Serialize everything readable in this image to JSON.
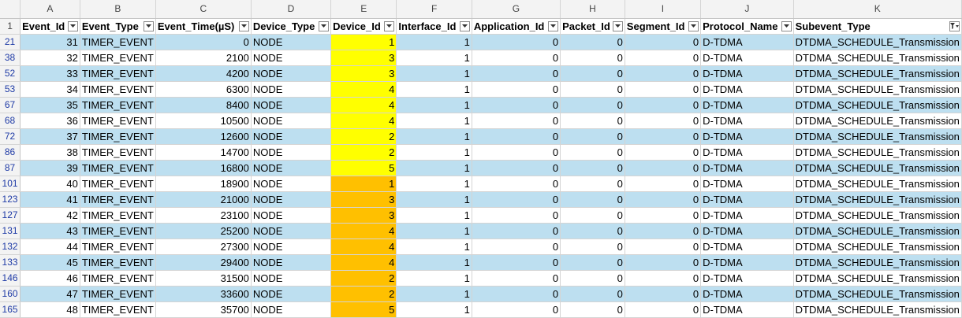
{
  "colors": {
    "band": "#bddff0",
    "device_yellow": "#ffff00",
    "device_orange": "#ffc000",
    "row_number": "#1f3ba6"
  },
  "column_letters": [
    "A",
    "B",
    "C",
    "D",
    "E",
    "F",
    "G",
    "H",
    "I",
    "J",
    "K"
  ],
  "header_row_number": "1",
  "headers": [
    "Event_Id",
    "Event_Type",
    "Event_Time(µS)",
    "Device_Type",
    "Device_Id",
    "Interface_Id",
    "Application_Id",
    "Packet_Id",
    "Segment_Id",
    "Protocol_Name",
    "Subevent_Type"
  ],
  "active_filter_column": "Subevent_Type",
  "rows": [
    {
      "rownum": "21",
      "cells": [
        "31",
        "TIMER_EVENT",
        "0",
        "NODE",
        "1",
        "1",
        "0",
        "0",
        "0",
        "D-TDMA",
        "DTDMA_SCHEDULE_Transmission"
      ],
      "device_highlight": "yellow"
    },
    {
      "rownum": "38",
      "cells": [
        "32",
        "TIMER_EVENT",
        "2100",
        "NODE",
        "3",
        "1",
        "0",
        "0",
        "0",
        "D-TDMA",
        "DTDMA_SCHEDULE_Transmission"
      ],
      "device_highlight": "yellow"
    },
    {
      "rownum": "52",
      "cells": [
        "33",
        "TIMER_EVENT",
        "4200",
        "NODE",
        "3",
        "1",
        "0",
        "0",
        "0",
        "D-TDMA",
        "DTDMA_SCHEDULE_Transmission"
      ],
      "device_highlight": "yellow"
    },
    {
      "rownum": "53",
      "cells": [
        "34",
        "TIMER_EVENT",
        "6300",
        "NODE",
        "4",
        "1",
        "0",
        "0",
        "0",
        "D-TDMA",
        "DTDMA_SCHEDULE_Transmission"
      ],
      "device_highlight": "yellow"
    },
    {
      "rownum": "67",
      "cells": [
        "35",
        "TIMER_EVENT",
        "8400",
        "NODE",
        "4",
        "1",
        "0",
        "0",
        "0",
        "D-TDMA",
        "DTDMA_SCHEDULE_Transmission"
      ],
      "device_highlight": "yellow"
    },
    {
      "rownum": "68",
      "cells": [
        "36",
        "TIMER_EVENT",
        "10500",
        "NODE",
        "4",
        "1",
        "0",
        "0",
        "0",
        "D-TDMA",
        "DTDMA_SCHEDULE_Transmission"
      ],
      "device_highlight": "yellow"
    },
    {
      "rownum": "72",
      "cells": [
        "37",
        "TIMER_EVENT",
        "12600",
        "NODE",
        "2",
        "1",
        "0",
        "0",
        "0",
        "D-TDMA",
        "DTDMA_SCHEDULE_Transmission"
      ],
      "device_highlight": "yellow"
    },
    {
      "rownum": "86",
      "cells": [
        "38",
        "TIMER_EVENT",
        "14700",
        "NODE",
        "2",
        "1",
        "0",
        "0",
        "0",
        "D-TDMA",
        "DTDMA_SCHEDULE_Transmission"
      ],
      "device_highlight": "yellow"
    },
    {
      "rownum": "87",
      "cells": [
        "39",
        "TIMER_EVENT",
        "16800",
        "NODE",
        "5",
        "1",
        "0",
        "0",
        "0",
        "D-TDMA",
        "DTDMA_SCHEDULE_Transmission"
      ],
      "device_highlight": "yellow"
    },
    {
      "rownum": "101",
      "cells": [
        "40",
        "TIMER_EVENT",
        "18900",
        "NODE",
        "1",
        "1",
        "0",
        "0",
        "0",
        "D-TDMA",
        "DTDMA_SCHEDULE_Transmission"
      ],
      "device_highlight": "orange"
    },
    {
      "rownum": "123",
      "cells": [
        "41",
        "TIMER_EVENT",
        "21000",
        "NODE",
        "3",
        "1",
        "0",
        "0",
        "0",
        "D-TDMA",
        "DTDMA_SCHEDULE_Transmission"
      ],
      "device_highlight": "orange"
    },
    {
      "rownum": "127",
      "cells": [
        "42",
        "TIMER_EVENT",
        "23100",
        "NODE",
        "3",
        "1",
        "0",
        "0",
        "0",
        "D-TDMA",
        "DTDMA_SCHEDULE_Transmission"
      ],
      "device_highlight": "orange"
    },
    {
      "rownum": "131",
      "cells": [
        "43",
        "TIMER_EVENT",
        "25200",
        "NODE",
        "4",
        "1",
        "0",
        "0",
        "0",
        "D-TDMA",
        "DTDMA_SCHEDULE_Transmission"
      ],
      "device_highlight": "orange"
    },
    {
      "rownum": "132",
      "cells": [
        "44",
        "TIMER_EVENT",
        "27300",
        "NODE",
        "4",
        "1",
        "0",
        "0",
        "0",
        "D-TDMA",
        "DTDMA_SCHEDULE_Transmission"
      ],
      "device_highlight": "orange"
    },
    {
      "rownum": "133",
      "cells": [
        "45",
        "TIMER_EVENT",
        "29400",
        "NODE",
        "4",
        "1",
        "0",
        "0",
        "0",
        "D-TDMA",
        "DTDMA_SCHEDULE_Transmission"
      ],
      "device_highlight": "orange"
    },
    {
      "rownum": "146",
      "cells": [
        "46",
        "TIMER_EVENT",
        "31500",
        "NODE",
        "2",
        "1",
        "0",
        "0",
        "0",
        "D-TDMA",
        "DTDMA_SCHEDULE_Transmission"
      ],
      "device_highlight": "orange"
    },
    {
      "rownum": "160",
      "cells": [
        "47",
        "TIMER_EVENT",
        "33600",
        "NODE",
        "2",
        "1",
        "0",
        "0",
        "0",
        "D-TDMA",
        "DTDMA_SCHEDULE_Transmission"
      ],
      "device_highlight": "orange"
    },
    {
      "rownum": "165",
      "cells": [
        "48",
        "TIMER_EVENT",
        "35700",
        "NODE",
        "5",
        "1",
        "0",
        "0",
        "0",
        "D-TDMA",
        "DTDMA_SCHEDULE_Transmission"
      ],
      "device_highlight": "orange"
    }
  ]
}
